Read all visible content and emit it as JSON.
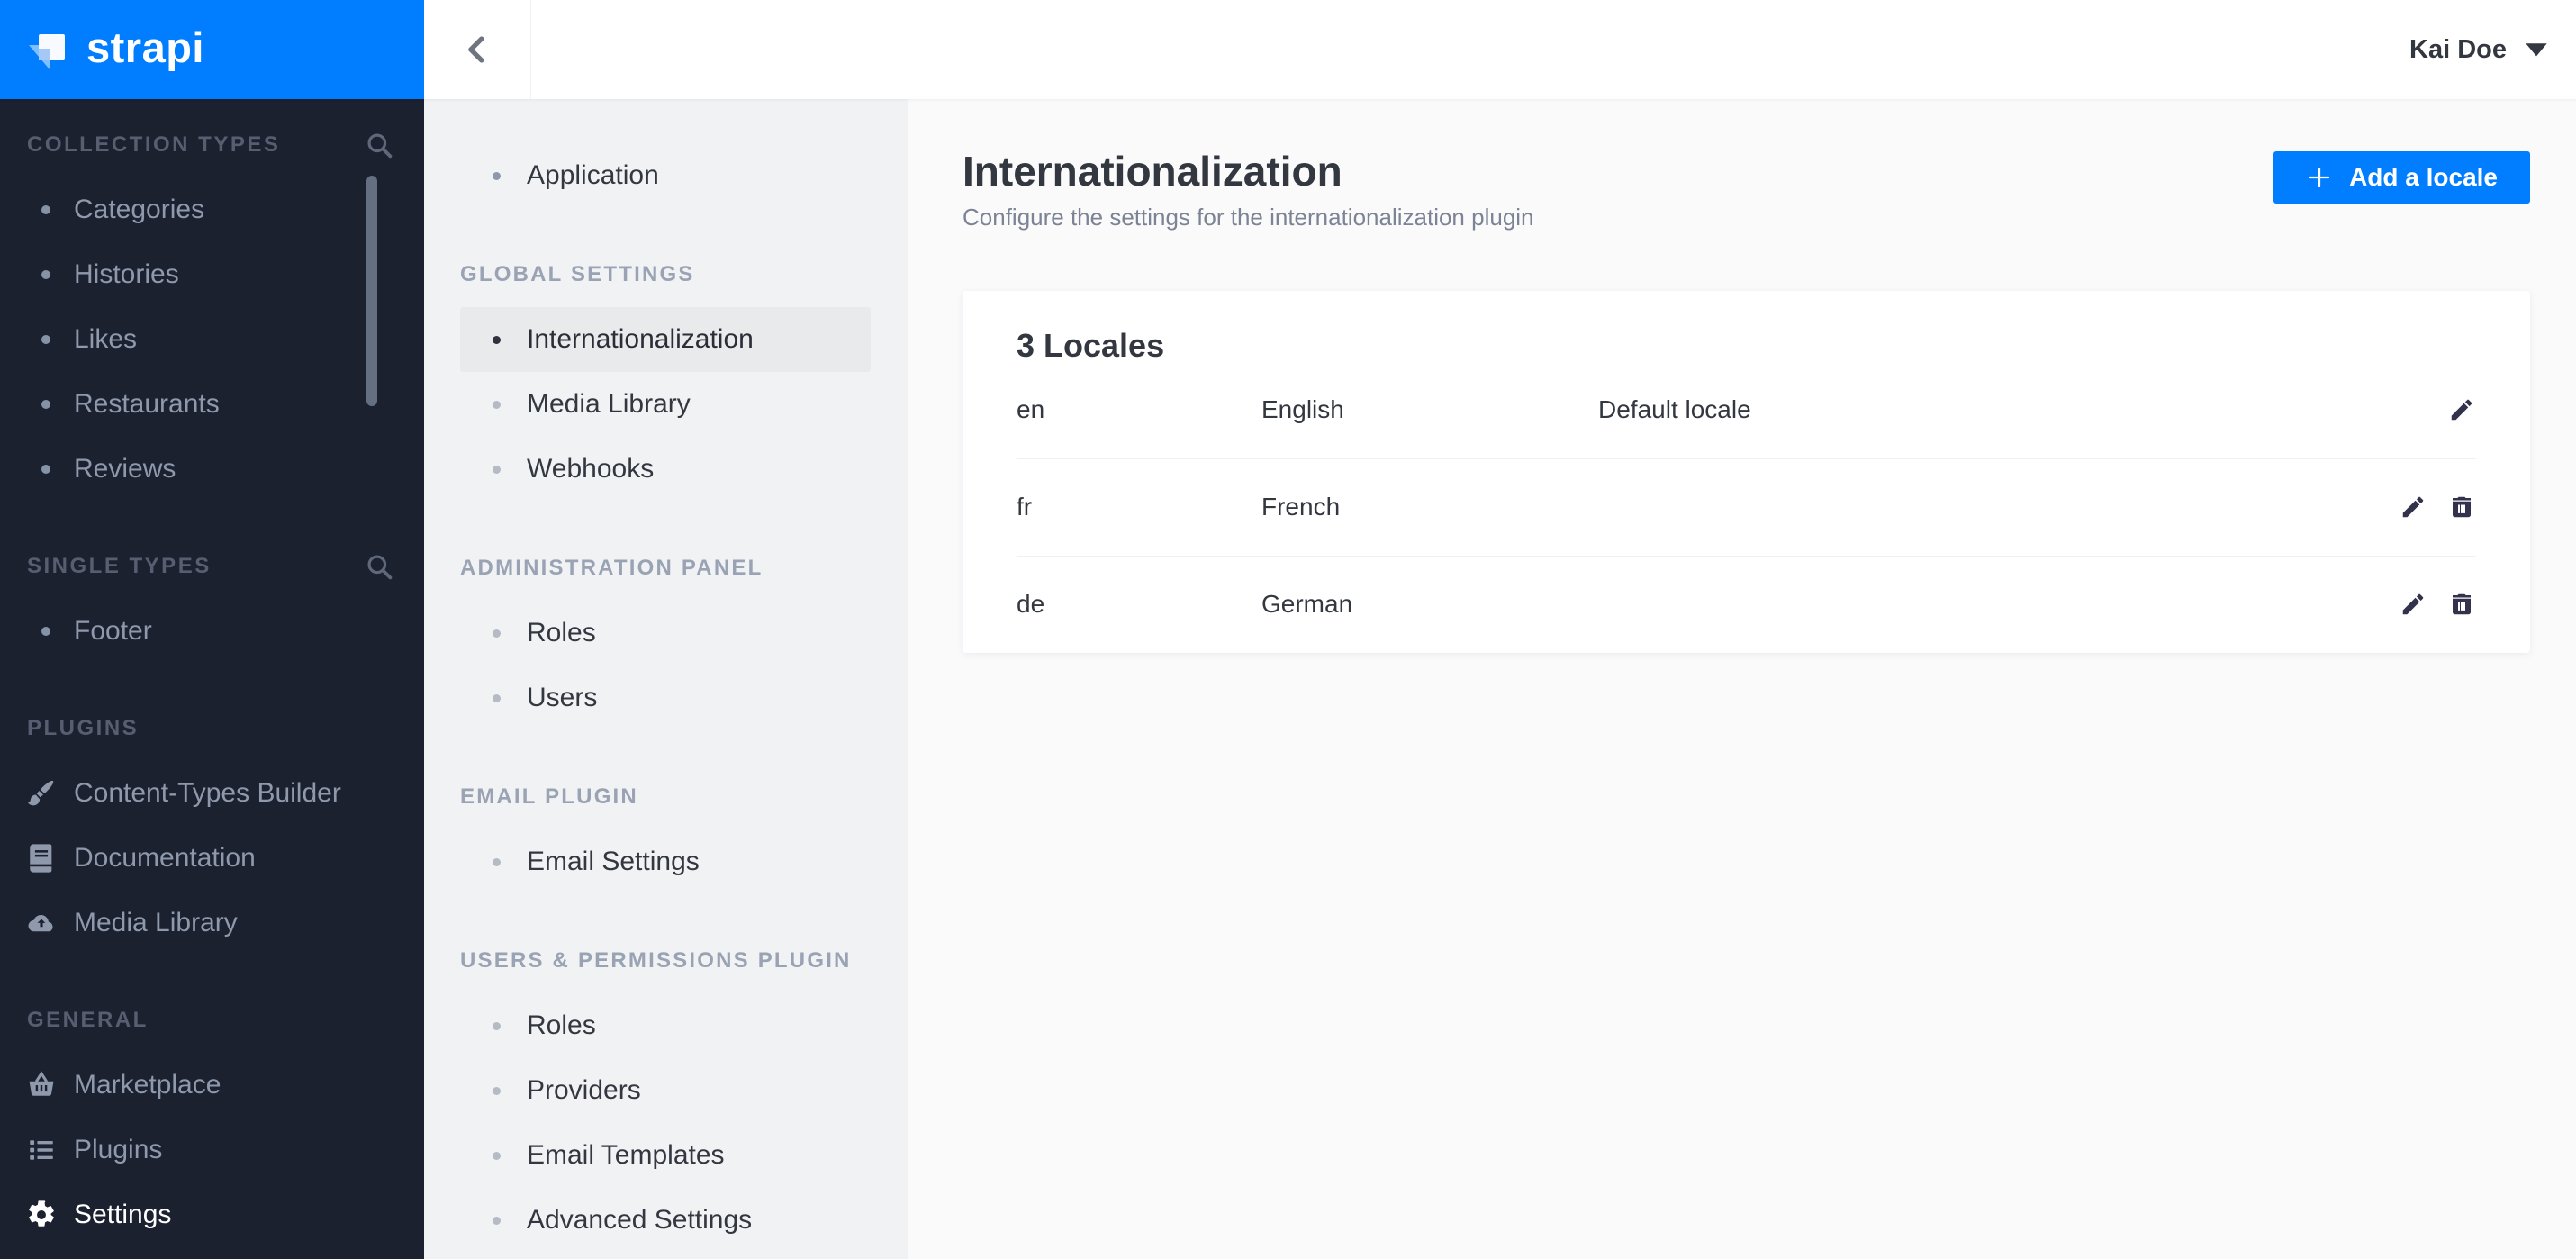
{
  "colors": {
    "accent": "#007eff",
    "sidebar_bg": "#1c2130",
    "active_highlight": "#e9eaeb"
  },
  "brand": {
    "name": "strapi"
  },
  "topbar": {
    "back_icon": "chevron-left-icon",
    "user_name": "Kai Doe",
    "user_caret_icon": "caret-down-icon"
  },
  "sidebar": {
    "sections": [
      {
        "label": "COLLECTION TYPES",
        "icon": "search-icon",
        "items": [
          {
            "label": "Categories"
          },
          {
            "label": "Histories"
          },
          {
            "label": "Likes"
          },
          {
            "label": "Restaurants"
          },
          {
            "label": "Reviews"
          }
        ]
      },
      {
        "label": "SINGLE TYPES",
        "icon": "search-icon",
        "items": [
          {
            "label": "Footer"
          }
        ]
      },
      {
        "label": "PLUGINS",
        "items": [
          {
            "label": "Content-Types Builder",
            "icon": "brush-icon"
          },
          {
            "label": "Documentation",
            "icon": "book-icon"
          },
          {
            "label": "Media Library",
            "icon": "cloud-upload-icon"
          }
        ]
      },
      {
        "label": "GENERAL",
        "items": [
          {
            "label": "Marketplace",
            "icon": "basket-icon"
          },
          {
            "label": "Plugins",
            "icon": "list-icon"
          },
          {
            "label": "Settings",
            "icon": "gear-icon"
          }
        ]
      }
    ]
  },
  "subnav": {
    "top_items": [
      {
        "label": "Application"
      }
    ],
    "sections": [
      {
        "label": "GLOBAL SETTINGS",
        "items": [
          {
            "label": "Internationalization"
          },
          {
            "label": "Media Library"
          },
          {
            "label": "Webhooks"
          }
        ]
      },
      {
        "label": "ADMINISTRATION PANEL",
        "items": [
          {
            "label": "Roles"
          },
          {
            "label": "Users"
          }
        ]
      },
      {
        "label": "EMAIL PLUGIN",
        "items": [
          {
            "label": "Email Settings"
          }
        ]
      },
      {
        "label": "USERS & PERMISSIONS PLUGIN",
        "items": [
          {
            "label": "Roles"
          },
          {
            "label": "Providers"
          },
          {
            "label": "Email Templates"
          },
          {
            "label": "Advanced Settings"
          }
        ]
      }
    ]
  },
  "main": {
    "title": "Internationalization",
    "subtitle": "Configure the settings for the internationalization plugin",
    "add_button": {
      "label": "Add a locale",
      "icon": "plus-icon"
    },
    "locales_card": {
      "title": "3 Locales",
      "rows": [
        {
          "code": "en",
          "name": "English",
          "note": "Default locale"
        },
        {
          "code": "fr",
          "name": "French",
          "note": ""
        },
        {
          "code": "de",
          "name": "German",
          "note": ""
        }
      ]
    }
  }
}
